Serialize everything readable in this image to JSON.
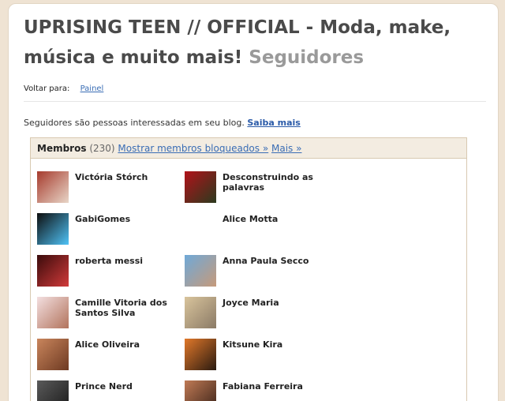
{
  "blog": {
    "title": "UPRISING TEEN // OFFICIAL - Moda, make, música e muito mais!",
    "subtitle": "Seguidores"
  },
  "nav": {
    "back_label": "Voltar para:",
    "back_link": "Painel"
  },
  "intro": {
    "text": "Seguidores são pessoas interessadas em seu blog.",
    "link": "Saiba mais"
  },
  "members_panel": {
    "heading": "Membros",
    "count": "(230)",
    "blocked_link": "Mostrar membros bloqueados »",
    "more_link": "Mais »",
    "members": [
      {
        "name": "Victória Stórch",
        "colors": [
          "#a63a2c",
          "#e8d6c8"
        ]
      },
      {
        "name": "Desconstruindo as palavras",
        "colors": [
          "#b1121a",
          "#2b3a1e"
        ]
      },
      {
        "name": "GabiGomes",
        "colors": [
          "#0d0d0d",
          "#4fc3f7"
        ]
      },
      {
        "name": "Alice Motta",
        "colors": [
          "#ffffff",
          "#ffffff"
        ]
      },
      {
        "name": "roberta messi",
        "colors": [
          "#3a0b0b",
          "#d13a3a"
        ]
      },
      {
        "name": "Anna Paula Secco",
        "colors": [
          "#6fa9d8",
          "#c69a7a"
        ]
      },
      {
        "name": "Camille Vitoria dos Santos Silva",
        "colors": [
          "#f3dfe0",
          "#b2735c"
        ]
      },
      {
        "name": "Joyce Maria",
        "colors": [
          "#d9c49c",
          "#8a7a66"
        ]
      },
      {
        "name": "Alice Oliveira",
        "colors": [
          "#c9855c",
          "#6e3a22"
        ]
      },
      {
        "name": "Kitsune Kira",
        "colors": [
          "#e1782a",
          "#2a1a10"
        ]
      },
      {
        "name": "Prince Nerd",
        "colors": [
          "#5a5a5a",
          "#1a1a1a"
        ]
      },
      {
        "name": "Fabiana Ferreira",
        "colors": [
          "#c07a55",
          "#3a2218"
        ]
      }
    ]
  }
}
